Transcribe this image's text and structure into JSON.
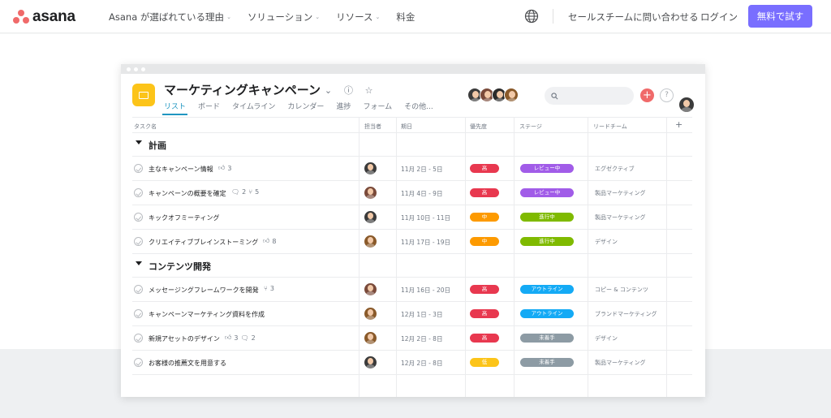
{
  "brand": {
    "name": "asana"
  },
  "nav": {
    "items": [
      {
        "label": "Asana が選ばれている理由",
        "has_dropdown": true
      },
      {
        "label": "ソリューション",
        "has_dropdown": true
      },
      {
        "label": "リソース",
        "has_dropdown": true
      },
      {
        "label": "料金",
        "has_dropdown": false
      }
    ],
    "globe_icon": "globe-icon",
    "contact": "セールスチームに問い合わせる",
    "login": "ログイン",
    "cta": "無料で試す"
  },
  "colors": {
    "brand_coral": "#f06a6a",
    "cta_purple": "#796eff",
    "project_icon": "#fcc419",
    "tab_active": "#2096c1"
  },
  "project": {
    "title": "マーケティングキャンペーン",
    "tabs": [
      "リスト",
      "ボード",
      "タイムライン",
      "カレンダー",
      "進捗",
      "フォーム",
      "その他..."
    ],
    "active_tab": "リスト"
  },
  "table": {
    "headers": {
      "task": "タスク名",
      "assignee": "担当者",
      "due": "期日",
      "priority": "優先度",
      "stage": "ステージ",
      "team": "リードチーム",
      "add": "+"
    },
    "sections": [
      {
        "name": "計画",
        "rows": [
          {
            "name": "主なキャンペーン情報",
            "likes": "3",
            "comments": "",
            "subtasks": "",
            "due": "11月 2日 - 5日",
            "priority": "高",
            "stage": "レビュー中",
            "team": "エグゼクティブ"
          },
          {
            "name": "キャンペーンの概要を確定",
            "likes": "",
            "comments": "2",
            "subtasks": "5",
            "due": "11月 4日 - 9日",
            "priority": "高",
            "stage": "レビュー中",
            "team": "製品マーケティング"
          },
          {
            "name": "キックオフミーティング",
            "likes": "",
            "comments": "",
            "subtasks": "",
            "due": "11月 10日 - 11日",
            "priority": "中",
            "stage": "進行中",
            "team": "製品マーケティング"
          },
          {
            "name": "クリエイティブブレインストーミング",
            "likes": "8",
            "comments": "",
            "subtasks": "",
            "due": "11月 17日 - 19日",
            "priority": "中",
            "stage": "進行中",
            "team": "デザイン"
          }
        ]
      },
      {
        "name": "コンテンツ開発",
        "rows": [
          {
            "name": "メッセージングフレームワークを開発",
            "likes": "",
            "comments": "",
            "subtasks": "3",
            "due": "11月 16日 - 20日",
            "priority": "高",
            "stage": "アウトライン",
            "team": "コピー & コンテンツ"
          },
          {
            "name": "キャンペーンマーケティング資料を作成",
            "likes": "",
            "comments": "",
            "subtasks": "",
            "due": "12月 1日 - 3日",
            "priority": "高",
            "stage": "アウトライン",
            "team": "ブランドマーケティング"
          },
          {
            "name": "新規アセットのデザイン",
            "likes": "3",
            "comments": "2",
            "subtasks": "",
            "due": "12月 2日 - 8日",
            "priority": "高",
            "stage": "未着手",
            "team": "デザイン"
          },
          {
            "name": "お客様の推薦文を用意する",
            "likes": "",
            "comments": "",
            "subtasks": "",
            "due": "12月 2日 - 8日",
            "priority": "低",
            "stage": "未着手",
            "team": "製品マーケティング"
          }
        ]
      }
    ]
  },
  "priority_colors": {
    "高": "#e8384f",
    "中": "#fd9a00",
    "低": "#fcc419"
  },
  "stage_colors": {
    "レビュー中": "#a15ce8",
    "進行中": "#7fba00",
    "アウトライン": "#14aaf5",
    "未着手": "#8d9ba4"
  }
}
